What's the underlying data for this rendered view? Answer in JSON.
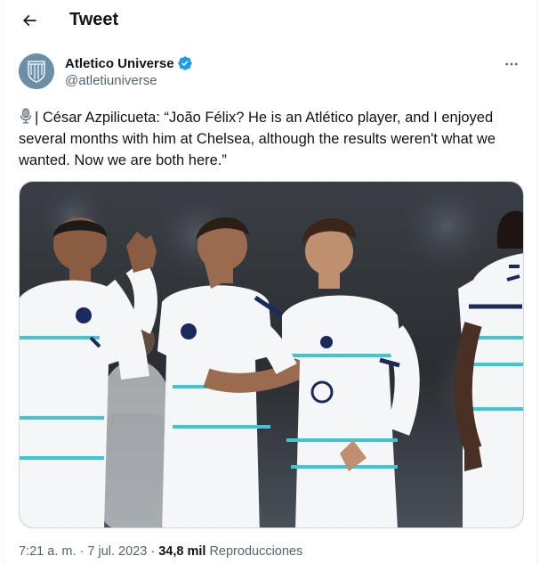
{
  "header": {
    "title": "Tweet"
  },
  "author": {
    "name": "Atletico Universe",
    "handle": "@atletiuniverse",
    "verified": true
  },
  "tweet": {
    "mic_glyph": "🎙",
    "text": "| César Azpilicueta: “João Félix? He is an Atlético player, and I enjoyed several months with him at Chelsea, although the results weren't what we wanted. Now we are both here.”"
  },
  "meta": {
    "time": "7:21 a. m.",
    "separator": "·",
    "date": "7 jul. 2023",
    "views_count": "34,8 mil",
    "views_label": "Reproducciones"
  },
  "colors": {
    "verified": "#1d9bf0",
    "secondary_text": "#536471",
    "primary_text": "#0f1419",
    "kit_white": "#f4f6f8",
    "kit_stripe": "#3ec6d6",
    "kit_navy": "#1a2a5c"
  },
  "icons": [
    "back-arrow-icon",
    "verified-badge-icon",
    "more-icon",
    "microphone-icon"
  ]
}
